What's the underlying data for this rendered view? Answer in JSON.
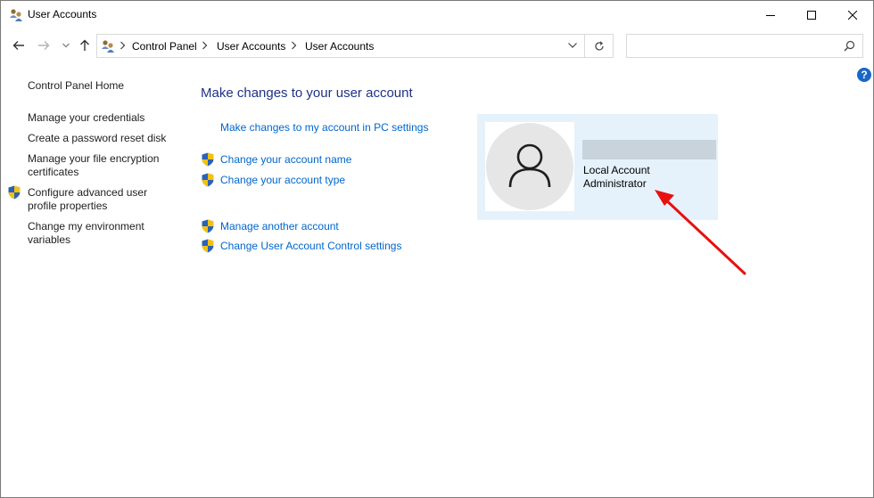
{
  "window": {
    "title": "User Accounts",
    "icon": "user-accounts-icon"
  },
  "caption_buttons": [
    "minimize-icon",
    "maximize-icon",
    "close-icon"
  ],
  "address": {
    "breadcrumb": [
      "Control Panel",
      "User Accounts",
      "User Accounts"
    ],
    "search_placeholder": ""
  },
  "left_nav": {
    "home": "Control Panel Home",
    "items": [
      {
        "label": "Manage your credentials",
        "shield": false
      },
      {
        "label": "Create a password reset disk",
        "shield": false
      },
      {
        "label_line1": "Manage your file encryption",
        "label_line2": "certificates",
        "shield": false
      },
      {
        "label_line1": "Configure advanced user",
        "label_line2": "profile properties",
        "shield": true
      },
      {
        "label_line1": "Change my environment",
        "label_line2": "variables",
        "shield": false
      }
    ]
  },
  "main": {
    "heading": "Make changes to your user account",
    "links": [
      {
        "label": "Make changes to my account in PC settings",
        "shield": false
      },
      {
        "label": "Change your account name",
        "shield": true
      },
      {
        "label": "Change your account type",
        "shield": true
      },
      {
        "label": "Manage another account",
        "shield": true
      },
      {
        "label": "Change User Account Control settings",
        "shield": true
      }
    ]
  },
  "account_tile": {
    "type": "Local Account",
    "role": "Administrator"
  },
  "colors": {
    "link": "#0066cc",
    "heading": "#1e3287",
    "tile_bg": "#e5f1fb",
    "annotation_arrow": "#e81010"
  }
}
